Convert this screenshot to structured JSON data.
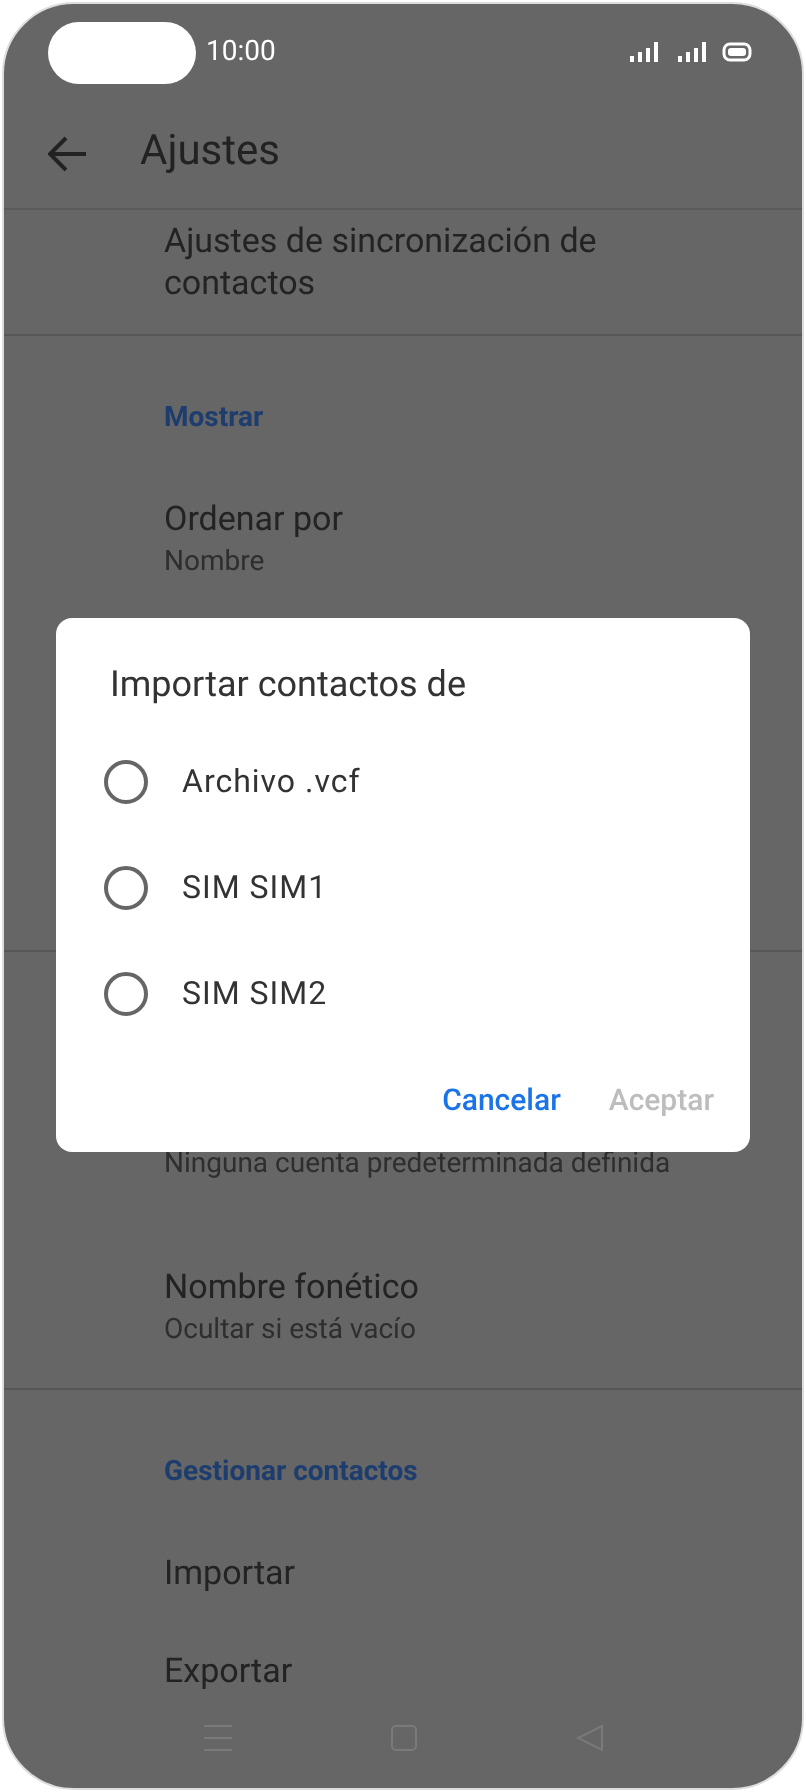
{
  "status_bar": {
    "time": "10:00"
  },
  "header": {
    "title": "Ajustes"
  },
  "settings": [
    {
      "kind": "item",
      "title": "Ajustes de sincronización de contactos"
    },
    {
      "kind": "divider"
    },
    {
      "kind": "section",
      "title": "Mostrar"
    },
    {
      "kind": "item",
      "title": "Ordenar por",
      "subtitle": "Nombre"
    },
    {
      "kind": "gap"
    },
    {
      "kind": "divider"
    },
    {
      "kind": "item",
      "subtitle": "Ninguna cuenta predeterminada definida"
    },
    {
      "kind": "item",
      "title": "Nombre fonético",
      "subtitle": "Ocultar si está vacío"
    },
    {
      "kind": "divider"
    },
    {
      "kind": "section",
      "title": "Gestionar contactos"
    },
    {
      "kind": "item",
      "title": "Importar"
    },
    {
      "kind": "item",
      "title": "Exportar"
    }
  ],
  "dialog": {
    "title": "Importar contactos de",
    "options": [
      {
        "label": "Archivo .vcf",
        "selected": false
      },
      {
        "label": "SIM SIM1",
        "selected": false
      },
      {
        "label": "SIM SIM2",
        "selected": false
      }
    ],
    "buttons": [
      {
        "label": "Cancelar",
        "disabled": false
      },
      {
        "label": "Aceptar",
        "disabled": true
      }
    ]
  }
}
